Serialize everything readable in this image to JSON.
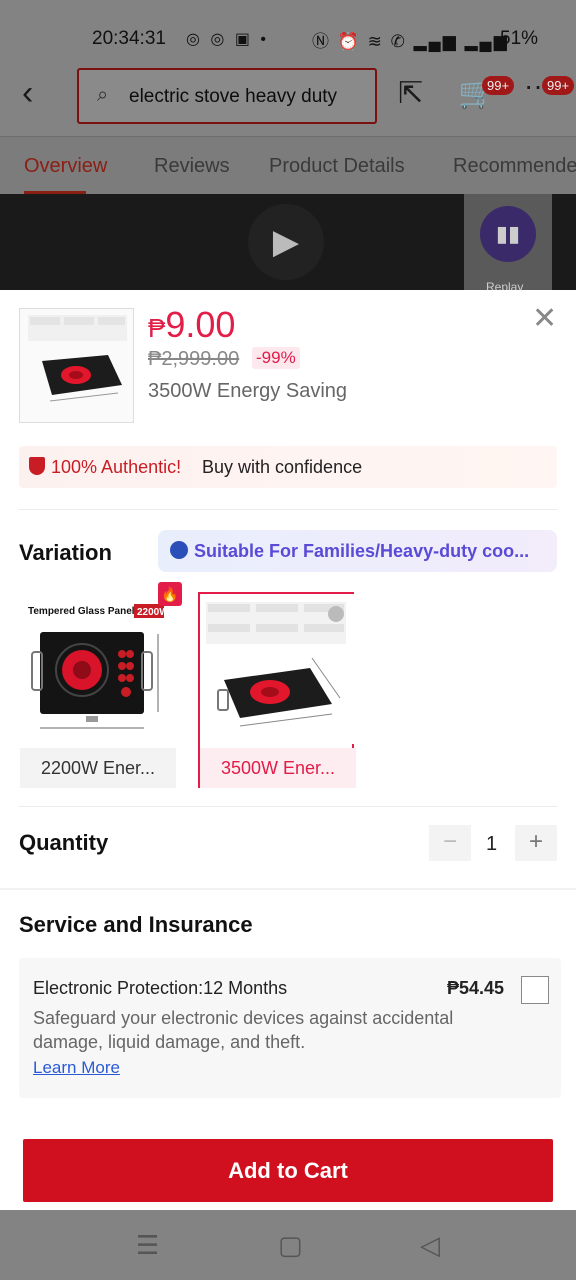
{
  "status_bar": {
    "time": "20:34:31",
    "battery": "51%",
    "left_icons": "messenger-icons",
    "right_icons": "nfc alarm wifi call signal"
  },
  "header": {
    "search_text": "electric stove heavy duty",
    "cart_badge": "99+",
    "more_badge": "99+"
  },
  "tabs": [
    {
      "label": "Overview",
      "active": true
    },
    {
      "label": "Reviews",
      "active": false
    },
    {
      "label": "Product Details",
      "active": false
    },
    {
      "label": "Recommended",
      "active": false
    }
  ],
  "video": {
    "replay_label": "Replay"
  },
  "sheet": {
    "currency": "₱",
    "price": "9.00",
    "old_price": "₱2,999.00",
    "discount": "-99%",
    "selected_variant": "3500W Energy Saving",
    "authentic_highlight": "100% Authentic!",
    "authentic_text": "Buy with confidence",
    "variation_title": "Variation",
    "suitable_text": "Suitable For Families/Heavy-duty coo...",
    "variants": [
      {
        "label": "2200W Ener...",
        "image_caption": "Tempered Glass Panel",
        "image_tag": "2200W",
        "selected": false
      },
      {
        "label": "3500W Ener...",
        "selected": true
      }
    ],
    "quantity_label": "Quantity",
    "quantity_minus": "−",
    "quantity": "1",
    "quantity_plus": "+",
    "service_title": "Service and Insurance",
    "service": {
      "name": "Electronic Protection:12 Months",
      "price": "₱54.45",
      "description": "Safeguard your electronic devices against accidental damage, liquid damage, and theft.",
      "learn_more": "Learn More"
    },
    "add_to_cart": "Add to Cart"
  },
  "colors": {
    "accent": "#e11d48",
    "cta": "#d0101f",
    "link": "#2a5bd6"
  }
}
